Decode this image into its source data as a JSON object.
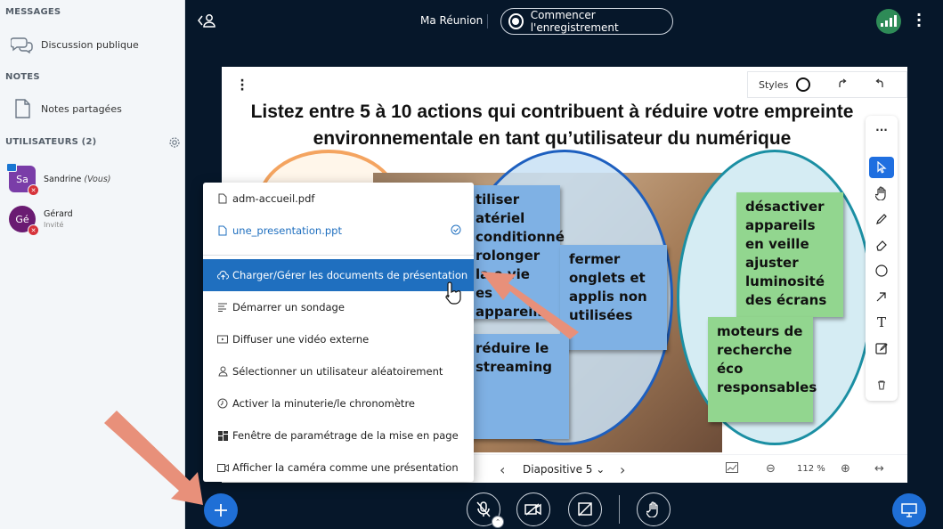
{
  "sidebar": {
    "messages_title": "MESSAGES",
    "public_chat": "Discussion publique",
    "notes_title": "NOTES",
    "shared_notes": "Notes partagées",
    "users_title": "UTILISATEURS (2)",
    "users": [
      {
        "initials": "Sa",
        "name": "Sandrine",
        "suffix": "(Vous)",
        "role": ""
      },
      {
        "initials": "Gé",
        "name": "Gérard",
        "suffix": "",
        "role": "Invité"
      }
    ]
  },
  "header": {
    "meeting_title": "Ma Réunion",
    "record_label": "Commencer l'enregistrement"
  },
  "slide": {
    "title_line1": "Listez entre 5 à 10 actions qui contribuent à réduire votre empreinte",
    "title_line2": "environnementale en tant qu’utilisateur du numérique",
    "styles_label": "Styles",
    "notes": {
      "n1": "tiliser atériel conditionné rolonger la e vie es appareils",
      "n2": "fermer onglets et applis non utilisées",
      "n3": "réduire le streaming",
      "n4": "désactiver appareils en veille  ajuster luminosité des écrans",
      "n5": "moteurs de recherche éco responsables"
    },
    "slide_selector": "Diapositive 5",
    "zoom": "112 %"
  },
  "menu": {
    "files": [
      "adm-accueil.pdf",
      "une_presentation.ppt"
    ],
    "items": [
      "Charger/Gérer les documents de présentation",
      "Démarrer un sondage",
      "Diffuser une vidéo externe",
      "Sélectionner un utilisateur aléatoirement",
      "Activer la minuterie/le chronomètre",
      "Fenêtre de paramétrage de la mise en page",
      "Afficher la caméra comme une présentation"
    ]
  },
  "colors": {
    "background": "#06172a",
    "accent": "#1f6fd6",
    "arrow": "#e8907a"
  }
}
